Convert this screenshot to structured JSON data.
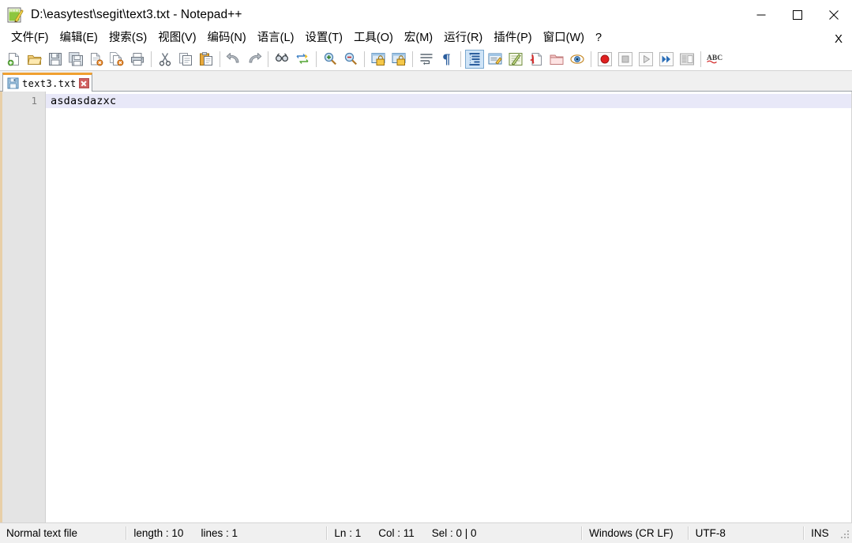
{
  "window": {
    "title": "D:\\easytest\\segit\\text3.txt - Notepad++",
    "app_icon": "notepad-plus-plus-icon",
    "controls": {
      "minimize": "minimize-icon",
      "maximize": "maximize-icon",
      "close": "close-icon"
    }
  },
  "menubar": {
    "items": [
      {
        "label": "文件(F)",
        "name": "menu-file"
      },
      {
        "label": "编辑(E)",
        "name": "menu-edit"
      },
      {
        "label": "搜索(S)",
        "name": "menu-search"
      },
      {
        "label": "视图(V)",
        "name": "menu-view"
      },
      {
        "label": "编码(N)",
        "name": "menu-encoding"
      },
      {
        "label": "语言(L)",
        "name": "menu-language"
      },
      {
        "label": "设置(T)",
        "name": "menu-settings"
      },
      {
        "label": "工具(O)",
        "name": "menu-tools"
      },
      {
        "label": "宏(M)",
        "name": "menu-macro"
      },
      {
        "label": "运行(R)",
        "name": "menu-run"
      },
      {
        "label": "插件(P)",
        "name": "menu-plugins"
      },
      {
        "label": "窗口(W)",
        "name": "menu-window"
      },
      {
        "label": "?",
        "name": "menu-help"
      }
    ],
    "close_document_label": "X"
  },
  "toolbar": {
    "groups": [
      [
        "new-file-icon",
        "open-file-icon",
        "save-icon",
        "save-all-icon",
        "close-file-icon",
        "close-all-files-icon",
        "print-icon"
      ],
      [
        "cut-icon",
        "copy-icon",
        "paste-icon"
      ],
      [
        "undo-icon",
        "redo-icon"
      ],
      [
        "find-icon",
        "replace-icon"
      ],
      [
        "zoom-in-icon",
        "zoom-out-icon"
      ],
      [
        "sync-vertical-scroll-icon",
        "sync-horizontal-scroll-icon"
      ],
      [
        "word-wrap-icon",
        "show-all-characters-icon"
      ],
      [
        "show-indent-guide-icon",
        "user-defined-language-icon",
        "function-list-icon",
        "document-map-icon",
        "folder-as-workspace-icon",
        "document-preview-icon"
      ],
      [
        "start-recording-macro-icon",
        "stop-recording-macro-icon",
        "play-macro-icon",
        "run-macro-multiple-icon",
        "save-macro-icon"
      ],
      [
        "spell-check-icon"
      ]
    ],
    "pressed": "show-indent-guide-icon"
  },
  "tabs": [
    {
      "label": "text3.txt",
      "icon": "saved-file-icon",
      "active": true,
      "close_label": "close-tab-icon"
    }
  ],
  "editor": {
    "lines": [
      {
        "number": "1",
        "text": "asdasdazxc",
        "current": true
      }
    ]
  },
  "statusbar": {
    "file_type": "Normal text file",
    "length_label": "length : 10",
    "lines_label": "lines : 1",
    "ln_label": "Ln : 1",
    "col_label": "Col : 11",
    "sel_label": "Sel : 0 | 0",
    "eol": "Windows (CR LF)",
    "encoding": "UTF-8",
    "insert_mode": "INS",
    "grip": "resize-grip-icon"
  },
  "colors": {
    "tab_active_top": "#f0a030",
    "current_line": "#e8e8f8",
    "gutter": "#e4e4e4",
    "statusbar": "#f0f0f0",
    "accent_close": "#e81123"
  }
}
